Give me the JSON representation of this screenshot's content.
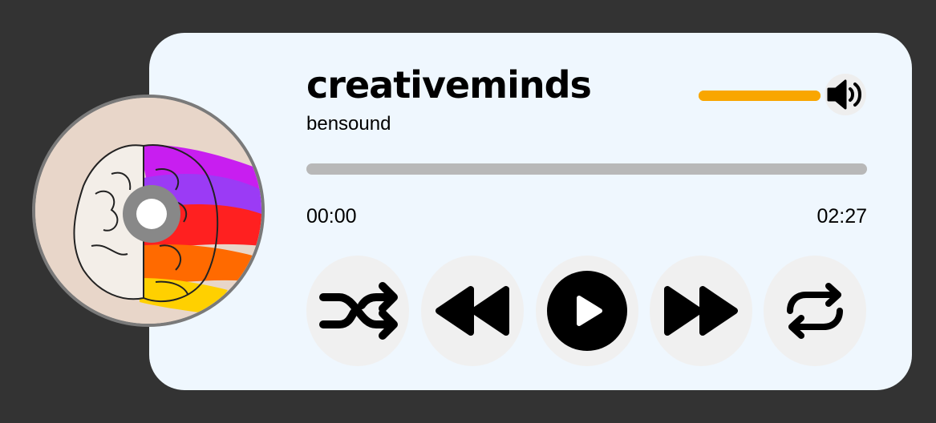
{
  "track": {
    "title": "creativeminds",
    "artist": "bensound"
  },
  "playback": {
    "current_time": "00:00",
    "duration": "02:27",
    "progress_fraction": 0
  },
  "volume": {
    "level_fraction": 1.0,
    "icon": "volume-icon"
  },
  "controls": [
    {
      "name": "shuffle",
      "icon": "shuffle-icon"
    },
    {
      "name": "previous",
      "icon": "rewind-icon"
    },
    {
      "name": "play",
      "icon": "play-icon"
    },
    {
      "name": "next",
      "icon": "fast-forward-icon"
    },
    {
      "name": "repeat",
      "icon": "repeat-icon"
    }
  ],
  "colors": {
    "background": "#333333",
    "card": "#eff7fe",
    "accent": "#f9a600",
    "progress_track": "#b8b8b8",
    "button_bg": "#f0f0f0"
  }
}
